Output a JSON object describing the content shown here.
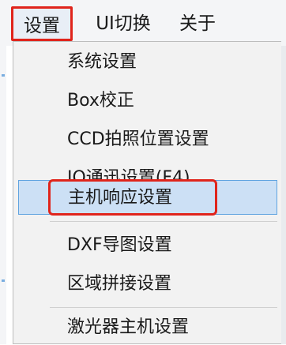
{
  "menubar": {
    "items": [
      {
        "label": "设置"
      },
      {
        "label": "UI切换"
      },
      {
        "label": "关于"
      }
    ]
  },
  "dropdown": {
    "items": [
      {
        "label": "系统设置"
      },
      {
        "label": "Box校正"
      },
      {
        "label": "CCD拍照位置设置"
      },
      {
        "label": "IO通迅设置(F4)"
      },
      {
        "label": "主机响应设置"
      },
      {
        "label": "DXF导图设置"
      },
      {
        "label": "区域拼接设置"
      },
      {
        "label": "激光器主机设置"
      }
    ]
  },
  "colors": {
    "highlight_outline": "#e0241b",
    "hover_fill": "#cce0f5",
    "hover_border": "#5fa3e0"
  }
}
